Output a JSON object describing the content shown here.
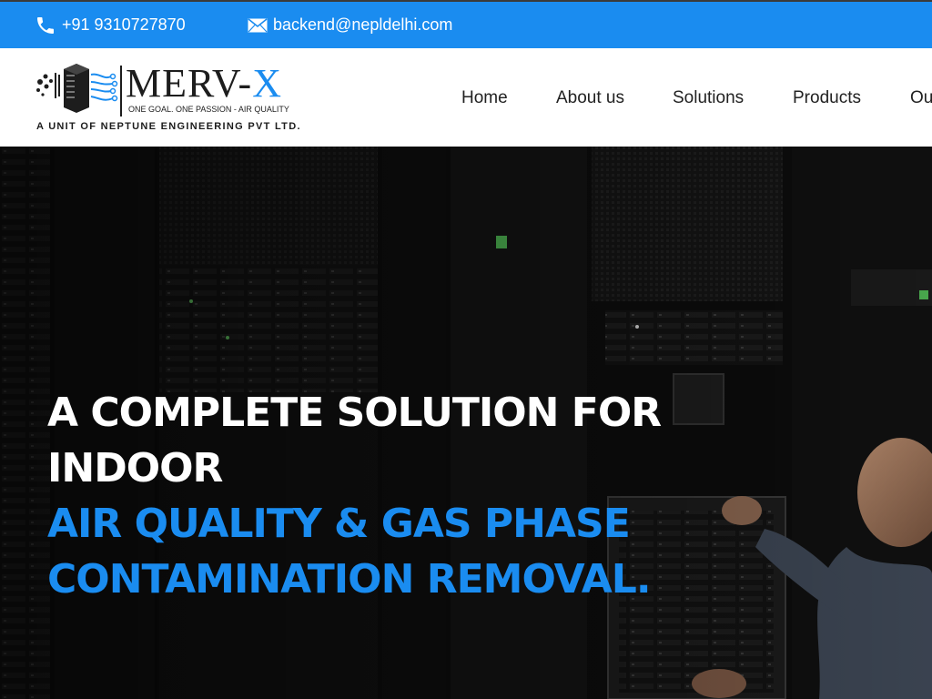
{
  "topbar": {
    "phone": "+91 9310727870",
    "email": "backend@nepldelhi.com",
    "phone_icon": "phone-icon",
    "email_icon": "envelope-icon",
    "background": "#1a8cf0"
  },
  "logo": {
    "brand_main": "MERV-",
    "brand_accent": "X",
    "tagline": "ONE GOAL. ONE PASSION - AIR QUALITY",
    "unit": "A UNIT OF NEPTUNE ENGINEERING PVT LTD."
  },
  "nav": {
    "items": [
      {
        "label": "Home"
      },
      {
        "label": "About us"
      },
      {
        "label": "Solutions"
      },
      {
        "label": "Products"
      },
      {
        "label": "Ou"
      }
    ]
  },
  "hero": {
    "line1": "A COMPLETE SOLUTION FOR",
    "line2": "INDOOR",
    "line3": "AIR QUALITY & GAS PHASE",
    "line4": "CONTAMINATION REMOVAL.",
    "accent_color": "#1a8cf0"
  }
}
